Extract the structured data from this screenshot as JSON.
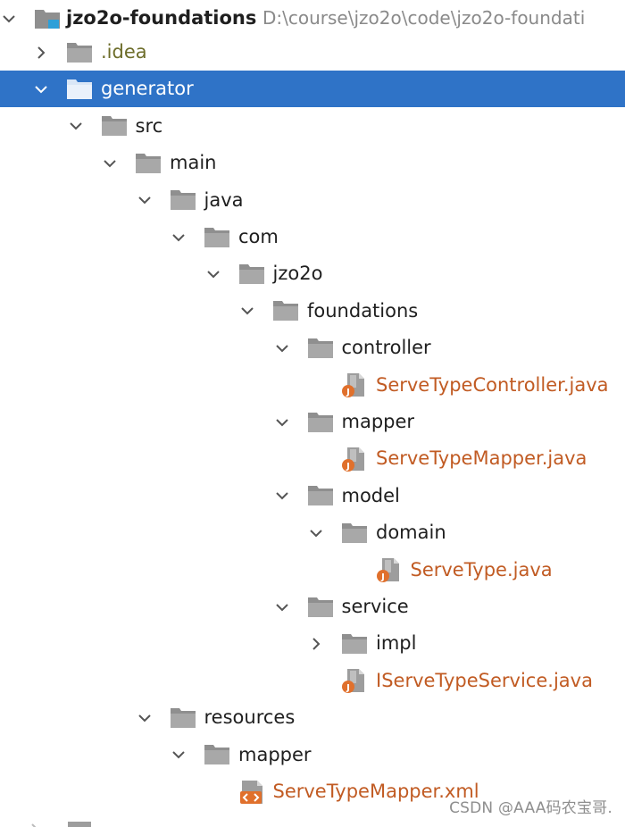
{
  "project": {
    "name": "jzo2o-foundations",
    "path": "D:\\course\\jzo2o\\code\\jzo2o-foundati"
  },
  "nodes": [
    {
      "name": ".idea",
      "kind": "folder",
      "depth": 1,
      "expanded": false,
      "style": "idea"
    },
    {
      "name": "generator",
      "kind": "folder",
      "depth": 1,
      "expanded": true,
      "selected": true
    },
    {
      "name": "src",
      "kind": "folder",
      "depth": 2,
      "expanded": true
    },
    {
      "name": "main",
      "kind": "folder",
      "depth": 3,
      "expanded": true
    },
    {
      "name": "java",
      "kind": "folder",
      "depth": 4,
      "expanded": true
    },
    {
      "name": "com",
      "kind": "folder",
      "depth": 5,
      "expanded": true
    },
    {
      "name": "jzo2o",
      "kind": "folder",
      "depth": 6,
      "expanded": true
    },
    {
      "name": "foundations",
      "kind": "folder",
      "depth": 7,
      "expanded": true
    },
    {
      "name": "controller",
      "kind": "folder",
      "depth": 8,
      "expanded": true
    },
    {
      "name": "ServeTypeController.java",
      "kind": "java",
      "depth": 9
    },
    {
      "name": "mapper",
      "kind": "folder",
      "depth": 8,
      "expanded": true
    },
    {
      "name": "ServeTypeMapper.java",
      "kind": "java",
      "depth": 9
    },
    {
      "name": "model",
      "kind": "folder",
      "depth": 8,
      "expanded": true
    },
    {
      "name": "domain",
      "kind": "folder",
      "depth": 9,
      "expanded": true
    },
    {
      "name": "ServeType.java",
      "kind": "java",
      "depth": 10
    },
    {
      "name": "service",
      "kind": "folder",
      "depth": 8,
      "expanded": true
    },
    {
      "name": "impl",
      "kind": "folder",
      "depth": 9,
      "expanded": false
    },
    {
      "name": "IServeTypeService.java",
      "kind": "java",
      "depth": 9
    },
    {
      "name": "resources",
      "kind": "folder",
      "depth": 4,
      "expanded": true
    },
    {
      "name": "mapper",
      "kind": "folder",
      "depth": 5,
      "expanded": true
    },
    {
      "name": "ServeTypeMapper.xml",
      "kind": "xml",
      "depth": 6
    }
  ],
  "watermark": "CSDN @AAA码农宝哥.",
  "colors": {
    "selection": "#2f73c7",
    "file_name": "#c15b23",
    "excluded_folder": "#6d6d2a",
    "folder": "#9d9d9d",
    "path": "#8a8a8a"
  }
}
